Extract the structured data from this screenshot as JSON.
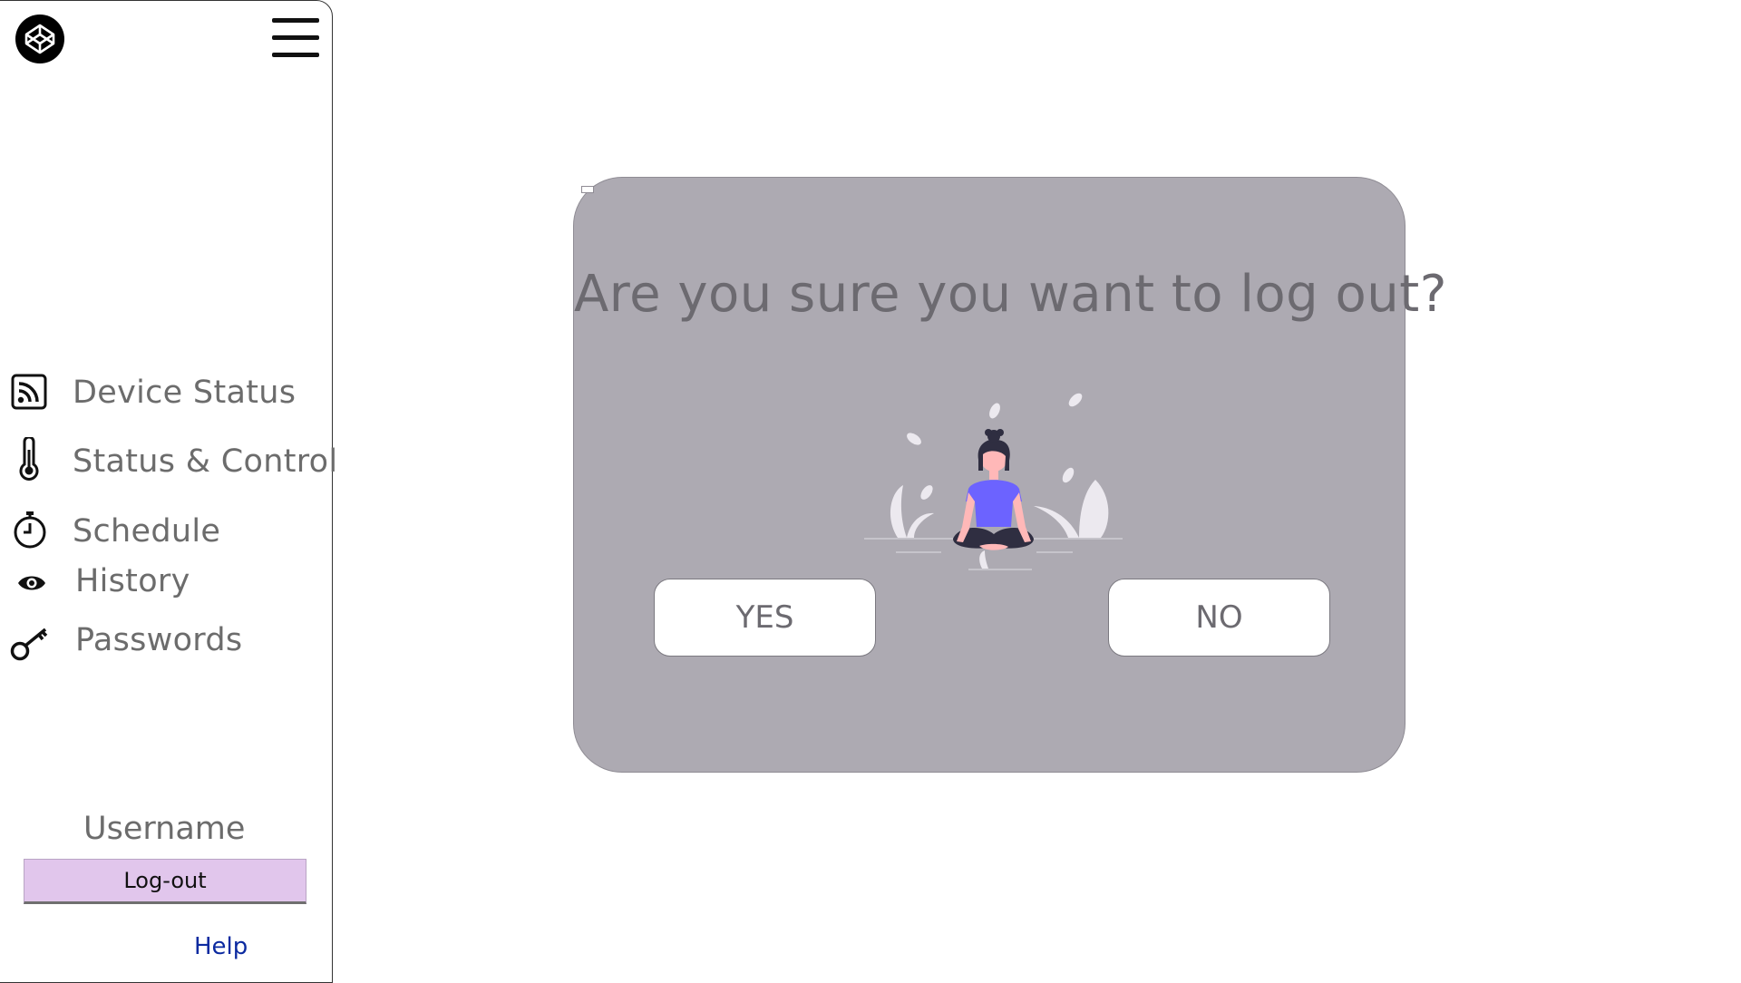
{
  "sidebar": {
    "logo_icon": "codepen-logo-icon",
    "menu_icon": "hamburger-menu-icon",
    "items": [
      {
        "label": "Device Status",
        "icon": "rss-feed-icon"
      },
      {
        "label": "Status & Control",
        "icon": "thermometer-icon"
      },
      {
        "label": "Schedule",
        "icon": "stopwatch-icon"
      },
      {
        "label": "History",
        "icon": "eye-icon"
      },
      {
        "label": "Passwords",
        "icon": "key-icon"
      }
    ],
    "username": "Username",
    "logout_label": "Log-out",
    "help_label": "Help"
  },
  "dialog": {
    "title": "Are you sure you want to log out?",
    "yes_label": "YES",
    "no_label": "NO",
    "illustration": "meditating-woman-illustration"
  },
  "colors": {
    "dialog_bg": "#adaab2",
    "logout_bg": "#e1c6ec",
    "shirt": "#6c63ff",
    "help_link": "#0b2aa0",
    "text_gray": "#6c6c6c"
  }
}
